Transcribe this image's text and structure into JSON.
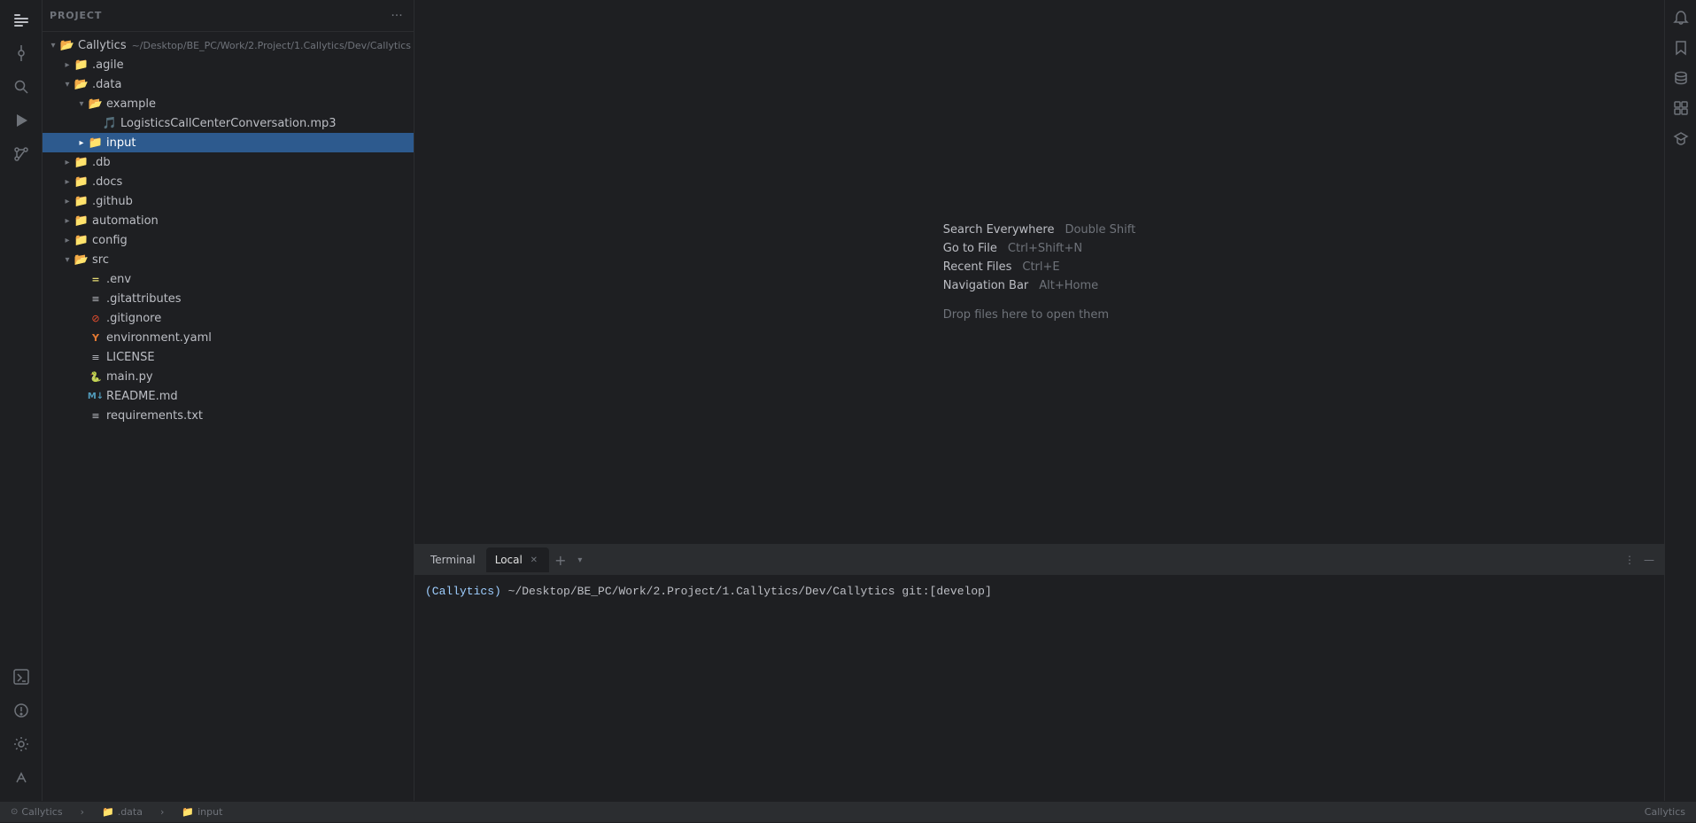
{
  "app": {
    "title": "Project"
  },
  "sidebar": {
    "header": "Project",
    "root": {
      "name": "Callytics",
      "path": "~/Desktop/BE_PC/Work/2.Project/1.Callytics/Dev/Callytics"
    },
    "tree": [
      {
        "id": "callytics",
        "label": "Callytics",
        "path": "~/Desktop/BE_PC/Work/2.Project/1.Callytics/Dev/Callytics",
        "type": "root-folder",
        "depth": 0,
        "expanded": true,
        "icon": "folder-open"
      },
      {
        "id": "agile",
        "label": ".agile",
        "type": "folder",
        "depth": 1,
        "expanded": false,
        "icon": "folder"
      },
      {
        "id": "data",
        "label": ".data",
        "type": "folder",
        "depth": 1,
        "expanded": true,
        "icon": "folder-open"
      },
      {
        "id": "example",
        "label": "example",
        "type": "folder",
        "depth": 2,
        "expanded": true,
        "icon": "folder-open"
      },
      {
        "id": "logistics-mp3",
        "label": "LogisticsCallCenterConversation.mp3",
        "type": "file",
        "depth": 3,
        "icon": "mp3"
      },
      {
        "id": "input",
        "label": "input",
        "type": "folder-selected",
        "depth": 2,
        "expanded": false,
        "icon": "folder",
        "selected": true
      },
      {
        "id": "db",
        "label": ".db",
        "type": "folder",
        "depth": 1,
        "expanded": false,
        "icon": "folder"
      },
      {
        "id": "docs",
        "label": ".docs",
        "type": "folder",
        "depth": 1,
        "expanded": false,
        "icon": "folder"
      },
      {
        "id": "github",
        "label": ".github",
        "type": "folder",
        "depth": 1,
        "expanded": false,
        "icon": "folder"
      },
      {
        "id": "automation",
        "label": "automation",
        "type": "folder",
        "depth": 1,
        "expanded": false,
        "icon": "folder"
      },
      {
        "id": "config",
        "label": "config",
        "type": "folder",
        "depth": 1,
        "expanded": false,
        "icon": "folder"
      },
      {
        "id": "src",
        "label": "src",
        "type": "folder",
        "depth": 1,
        "expanded": true,
        "icon": "folder-open"
      },
      {
        "id": "env",
        "label": ".env",
        "type": "file",
        "depth": 2,
        "icon": "env"
      },
      {
        "id": "gitattributes",
        "label": ".gitattributes",
        "type": "file",
        "depth": 2,
        "icon": "txt"
      },
      {
        "id": "gitignore",
        "label": ".gitignore",
        "type": "file",
        "depth": 2,
        "icon": "git"
      },
      {
        "id": "environment-yaml",
        "label": "environment.yaml",
        "type": "file",
        "depth": 2,
        "icon": "yaml"
      },
      {
        "id": "license",
        "label": "LICENSE",
        "type": "file",
        "depth": 2,
        "icon": "license"
      },
      {
        "id": "main-py",
        "label": "main.py",
        "type": "file",
        "depth": 2,
        "icon": "python"
      },
      {
        "id": "readme-md",
        "label": "README.md",
        "type": "file",
        "depth": 2,
        "icon": "markdown"
      },
      {
        "id": "requirements-txt",
        "label": "requirements.txt",
        "type": "file",
        "depth": 2,
        "icon": "txt"
      }
    ]
  },
  "editor": {
    "welcome": [
      {
        "label": "Search Everywhere",
        "shortcut": "Double Shift"
      },
      {
        "label": "Go to File",
        "shortcut": "Ctrl+Shift+N"
      },
      {
        "label": "Recent Files",
        "shortcut": "Ctrl+E"
      },
      {
        "label": "Navigation Bar",
        "shortcut": "Alt+Home"
      }
    ],
    "drop_text": "Drop files here to open them"
  },
  "terminal": {
    "tabs": [
      {
        "label": "Terminal",
        "active": false
      },
      {
        "label": "Local",
        "active": true
      }
    ],
    "prompt": "(Callytics) ~/Desktop/BE_PC/Work/2.Project/1.Callytics/Dev/Callytics git:[develop]"
  },
  "statusbar": {
    "left": [
      {
        "icon": "circle-icon",
        "label": "Callytics"
      },
      {
        "icon": "breadcrumb-sep",
        "label": ">"
      },
      {
        "icon": "folder-icon",
        "label": ".data"
      },
      {
        "icon": "breadcrumb-sep",
        "label": ">"
      },
      {
        "icon": "folder-icon",
        "label": "input"
      }
    ],
    "right": [
      {
        "label": "Callytics"
      }
    ]
  },
  "activity_bar": {
    "top_icons": [
      {
        "id": "project-icon",
        "symbol": "📁",
        "label": "Project"
      },
      {
        "id": "commit-icon",
        "symbol": "⎇",
        "label": "Commit"
      },
      {
        "id": "search-icon",
        "symbol": "⊕",
        "label": "Search"
      },
      {
        "id": "run-icon",
        "symbol": "▶",
        "label": "Run"
      },
      {
        "id": "git-icon",
        "symbol": "⌥",
        "label": "Git"
      }
    ],
    "bottom_icons": [
      {
        "id": "terminal-icon",
        "symbol": "⬛",
        "label": "Terminal"
      },
      {
        "id": "problems-icon",
        "symbol": "⚠",
        "label": "Problems"
      },
      {
        "id": "services-icon",
        "symbol": "⚙",
        "label": "Services"
      },
      {
        "id": "vcs-icon",
        "symbol": "↕",
        "label": "VCS"
      }
    ]
  },
  "right_bar": {
    "icons": [
      {
        "id": "notifications-icon",
        "symbol": "🔔"
      },
      {
        "id": "bookmark-icon",
        "symbol": "🔖"
      },
      {
        "id": "db-icon",
        "symbol": "🗄"
      },
      {
        "id": "plugins-icon",
        "symbol": "🔌"
      },
      {
        "id": "learn-icon",
        "symbol": "📚"
      }
    ]
  }
}
